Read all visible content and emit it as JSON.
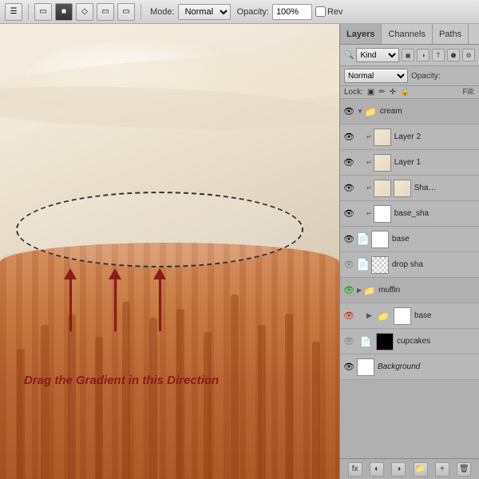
{
  "toolbar": {
    "mode_label": "Mode:",
    "mode_value": "Normal",
    "opacity_label": "Opacity:",
    "opacity_value": "100%",
    "rev_label": "Rev"
  },
  "panel": {
    "tabs": [
      {
        "label": "Layers",
        "id": "layers"
      },
      {
        "label": "Channels",
        "id": "channels"
      },
      {
        "label": "Paths",
        "id": "paths"
      }
    ],
    "search_placeholder": "Kind",
    "blend_mode": "Normal",
    "opacity_label": "Opacity:",
    "lock_label": "Lock:",
    "fill_label": "Fill:",
    "layers": [
      {
        "name": "cream",
        "type": "group",
        "visible": true,
        "indent": 0,
        "expanded": true
      },
      {
        "name": "Layer 2",
        "type": "layer",
        "visible": true,
        "indent": 1,
        "thumb": "cream"
      },
      {
        "name": "Layer 1",
        "type": "layer",
        "visible": true,
        "indent": 1,
        "thumb": "cream"
      },
      {
        "name": "Sha…",
        "type": "smart",
        "visible": true,
        "indent": 1,
        "thumb": "cream"
      },
      {
        "name": "base_sha",
        "type": "layer",
        "visible": true,
        "indent": 1,
        "thumb": "white"
      },
      {
        "name": "base",
        "type": "layer",
        "visible": true,
        "indent": 0,
        "thumb": "white"
      },
      {
        "name": "drop sha",
        "type": "layer",
        "visible": false,
        "indent": 0,
        "thumb": "checker"
      },
      {
        "name": "muffin",
        "type": "group",
        "visible": true,
        "indent": 0,
        "expanded": true,
        "green": true
      },
      {
        "name": "base",
        "type": "layer",
        "visible": true,
        "indent": 1,
        "thumb": "muffin",
        "red_eye": true
      },
      {
        "name": "cupcakes",
        "type": "layer",
        "visible": false,
        "indent": 0,
        "thumb": "black"
      },
      {
        "name": "Background",
        "type": "layer",
        "visible": true,
        "indent": 0,
        "thumb": "white",
        "italic": true
      }
    ],
    "bottom_buttons": [
      "fx",
      "mask",
      "adj",
      "group",
      "new",
      "trash"
    ]
  },
  "canvas": {
    "instruction_text": "Drag the Gradient in this Direction"
  }
}
